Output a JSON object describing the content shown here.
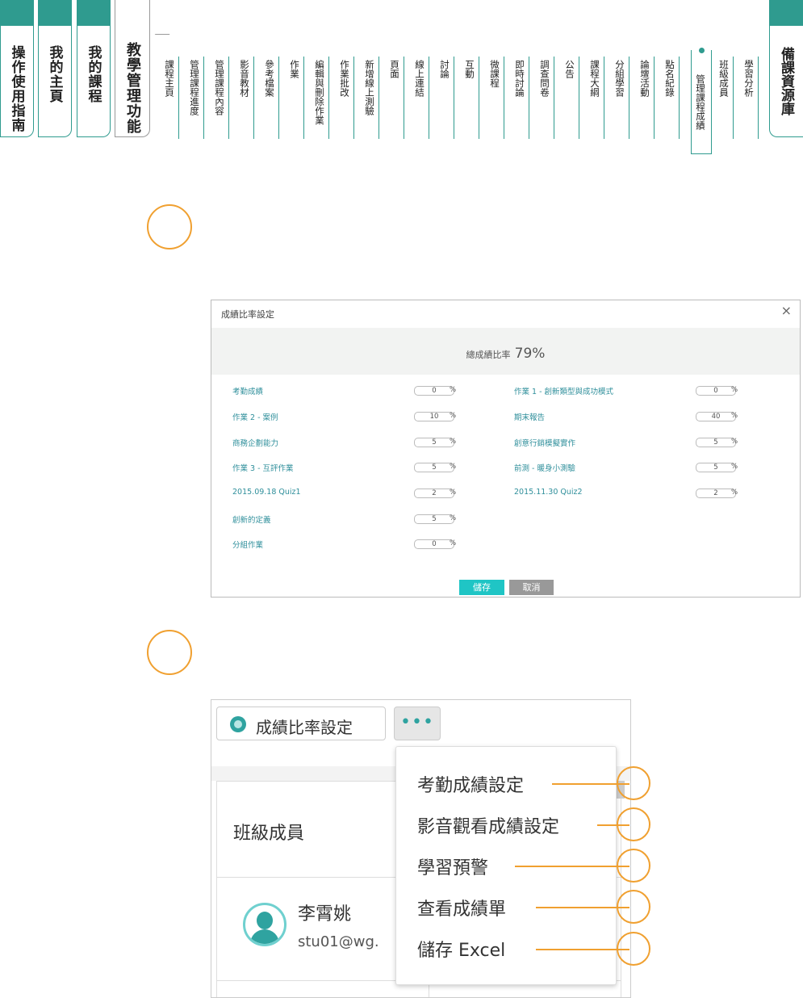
{
  "nav": {
    "main_tabs": [
      "操作使用指南",
      "我的主頁",
      "我的課程",
      "教學管理功能"
    ],
    "right_tab": "備課資源庫",
    "sub_tabs": [
      "課程主頁",
      "管理課程進度",
      "管理課程內容",
      "影音教材",
      "參考檔案",
      "作業",
      "編輯與刪除作業",
      "作業批改",
      "新增線上測驗",
      "頁面",
      "線上連結",
      "討論",
      "互動",
      "微課程",
      "即時討論",
      "調查問卷",
      "公告",
      "課程大綱",
      "分組學習",
      "論壇活動",
      "點名紀錄",
      "管理課程成績",
      "班級成員",
      "學習分析"
    ],
    "selected_sub_tab": "管理課程成績"
  },
  "dialog": {
    "title": "成績比率設定",
    "close": "×",
    "total_label": "總成績比率",
    "total_value": "79%",
    "left_items": [
      {
        "label": "考勤成績",
        "value": "0",
        "unit": "%"
      },
      {
        "label": "作業 2 - 案例",
        "value": "10",
        "unit": "%"
      },
      {
        "label": "商務企劃能力",
        "value": "5",
        "unit": "%"
      },
      {
        "label": "作業 3 - 互評作業",
        "value": "5",
        "unit": "%"
      },
      {
        "label": "2015.09.18 Quiz1",
        "value": "2",
        "unit": "%"
      },
      {
        "label": "創新的定義",
        "value": "5",
        "unit": "%"
      },
      {
        "label": "分組作業",
        "value": "0",
        "unit": "%"
      }
    ],
    "right_items": [
      {
        "label": "作業 1 - 創新類型與成功模式",
        "value": "0",
        "unit": "%"
      },
      {
        "label": "期末報告",
        "value": "40",
        "unit": "%"
      },
      {
        "label": "創意行銷模擬實作",
        "value": "5",
        "unit": "%"
      },
      {
        "label": "前測 - 暖身小測驗",
        "value": "5",
        "unit": "%"
      },
      {
        "label": "2015.11.30 Quiz2",
        "value": "2",
        "unit": "%"
      }
    ],
    "save_label": "儲存",
    "cancel_label": "取消"
  },
  "menu_shot": {
    "rate_button": "成績比率設定",
    "more_button": "•••",
    "table_header": "班級成員",
    "member_name": "李霄姚",
    "member_email": "stu01@wg.",
    "dropdown_items": [
      "考勤成績設定",
      "影音觀看成績設定",
      "學習預警",
      "查看成績單",
      "儲存 Excel"
    ]
  },
  "colors": {
    "teal": "#2f9b8f",
    "accent_orange": "#f0a030",
    "save_button": "#1fc5c5",
    "link_text": "#2f8f9b"
  }
}
